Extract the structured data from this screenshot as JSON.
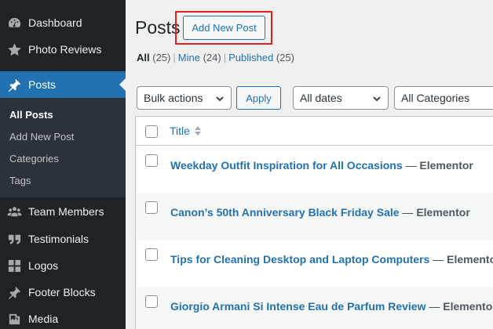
{
  "sidebar": {
    "items": [
      {
        "label": "Dashboard",
        "icon": "dashboard-icon"
      },
      {
        "label": "Photo Reviews",
        "icon": "star-icon"
      },
      {
        "label": "Posts",
        "icon": "pushpin-icon"
      },
      {
        "label": "Team Members",
        "icon": "groups-icon"
      },
      {
        "label": "Testimonials",
        "icon": "quote-icon"
      },
      {
        "label": "Logos",
        "icon": "grid-icon"
      },
      {
        "label": "Footer Blocks",
        "icon": "pushpin-icon"
      },
      {
        "label": "Media",
        "icon": "media-icon"
      }
    ],
    "submenu": [
      {
        "label": "All Posts"
      },
      {
        "label": "Add New Post"
      },
      {
        "label": "Categories"
      },
      {
        "label": "Tags"
      }
    ]
  },
  "header": {
    "title": "Posts",
    "add_new_label": "Add New Post"
  },
  "filters": {
    "all_label": "All",
    "all_count": "(25)",
    "mine_label": "Mine",
    "mine_count": "(24)",
    "published_label": "Published",
    "published_count": "(25)",
    "separator": "|"
  },
  "toolbar": {
    "bulk_actions": "Bulk actions",
    "apply_label": "Apply",
    "dates": "All dates",
    "categories": "All Categories"
  },
  "table": {
    "title_header": "Title",
    "state_separator": "—",
    "rows": [
      {
        "title": "Weekday Outfit Inspiration for All Occasions",
        "state": "Elementor"
      },
      {
        "title": "Canon’s 50th Anniversary Black Friday Sale",
        "state": "Elementor"
      },
      {
        "title": "Tips for Cleaning Desktop and Laptop Computers",
        "state": "Elementor"
      },
      {
        "title": "Giorgio Armani Si Intense Eau de Parfum Review",
        "state": "Elementor"
      }
    ]
  },
  "colors": {
    "sidebar_bg": "#1d2327",
    "accent": "#2271b1",
    "highlight_box": "#e4201f"
  }
}
